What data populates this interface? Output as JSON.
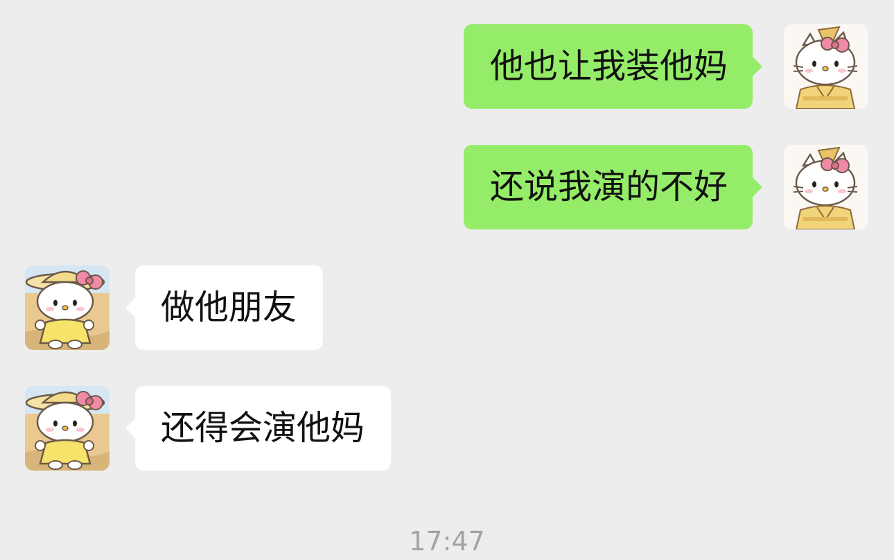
{
  "messages": [
    {
      "direction": "sent",
      "avatar_icon": "hello-kitty-kimono-avatar-icon",
      "text": "他也让我装他妈"
    },
    {
      "direction": "sent",
      "avatar_icon": "hello-kitty-kimono-avatar-icon",
      "text": "还说我演的不好"
    },
    {
      "direction": "received",
      "avatar_icon": "hello-kitty-straw-hat-avatar-icon",
      "text": "做他朋友"
    },
    {
      "direction": "received",
      "avatar_icon": "hello-kitty-straw-hat-avatar-icon",
      "text": "还得会演他妈"
    }
  ],
  "timestamp": "17:47",
  "colors": {
    "background": "#ededed",
    "sent_bubble": "#95ec69",
    "received_bubble": "#ffffff",
    "timestamp_text": "#a3a3a3"
  }
}
